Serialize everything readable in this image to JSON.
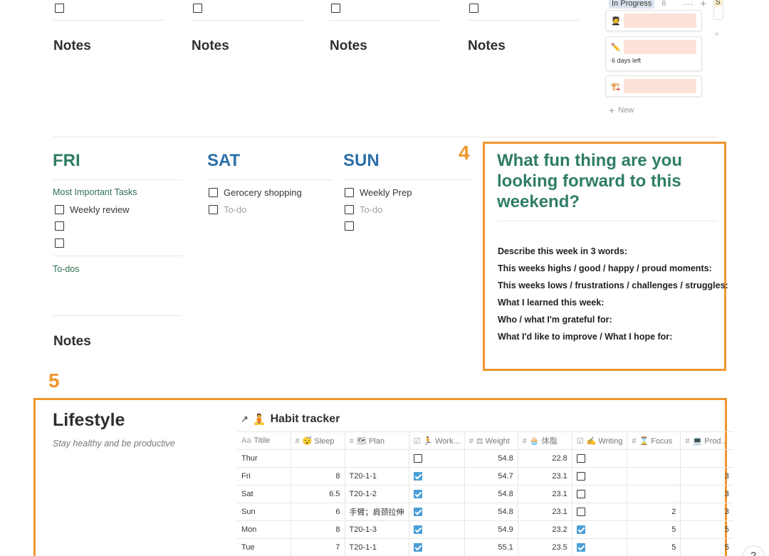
{
  "top_columns": {
    "notes_label": "Notes"
  },
  "kanban": {
    "status": "In Progress",
    "count": "6",
    "more_icon": "ellipsis-icon",
    "add_icon": "plus-icon",
    "cards": [
      {
        "emoji": "🧑‍🎓",
        "sub": ""
      },
      {
        "emoji": "✏️",
        "sub": "6 days left"
      },
      {
        "emoji": "🏗️",
        "sub": ""
      }
    ],
    "new_label": "New"
  },
  "days": {
    "fri": {
      "title": "FRI",
      "important_label": "Most Important Tasks",
      "tasks": [
        "Weekly review",
        "",
        ""
      ],
      "todos_label": "To-dos",
      "notes_label": "Notes"
    },
    "sat": {
      "title": "SAT",
      "tasks": [
        "Gerocery shopping"
      ],
      "placeholder": "To-do"
    },
    "sun": {
      "title": "SUN",
      "tasks": [
        "Weekly Prep"
      ],
      "placeholder": "To-do"
    }
  },
  "callouts": {
    "four": "4",
    "five": "5"
  },
  "weekend": {
    "title": "What fun thing are you looking forward to this weekend?",
    "prompts": [
      "Describe this week in 3 words:",
      "This weeks highs / good / happy / proud moments:",
      "This weeks lows / frustrations / challenges / struggles:",
      "What I learned this week:",
      "Who / what I'm grateful for:",
      "What I'd like to improve / What I hope for:"
    ]
  },
  "lifestyle": {
    "title": "Lifestyle",
    "subtitle": "Stay healthy and be productive",
    "tracker_arrow": "↗",
    "tracker_emoji": "🧘",
    "tracker_title": "Habit tracker",
    "columns": [
      {
        "icon": "Aa",
        "label": "Titile"
      },
      {
        "icon": "#",
        "label": "😴 Sleep"
      },
      {
        "icon": "≡",
        "label": "🗺 Plan"
      },
      {
        "icon": "☑",
        "label": "🏃 Work..."
      },
      {
        "icon": "#",
        "label": "⚖ Weight"
      },
      {
        "icon": "#",
        "label": "🧁 体脂"
      },
      {
        "icon": "☑",
        "label": "✍ Writing"
      },
      {
        "icon": "#",
        "label": "⌛ Focus"
      },
      {
        "icon": "#",
        "label": "💻 Prod..."
      }
    ],
    "rows": [
      {
        "title": "Thur",
        "sleep": "",
        "plan": "",
        "workout": false,
        "weight": "54.8",
        "fat": "22.8",
        "writing": false,
        "focus": "",
        "prod": ""
      },
      {
        "title": "Fri",
        "sleep": "8",
        "plan": "T20-1-1",
        "workout": true,
        "weight": "54.7",
        "fat": "23.1",
        "writing": false,
        "focus": "",
        "prod": "3"
      },
      {
        "title": "Sat",
        "sleep": "6.5",
        "plan": "T20-1-2",
        "workout": true,
        "weight": "54.8",
        "fat": "23.1",
        "writing": false,
        "focus": "",
        "prod": "3"
      },
      {
        "title": "Sun",
        "sleep": "6",
        "plan": "手臂；肩颈拉伸",
        "workout": true,
        "weight": "54.8",
        "fat": "23.1",
        "writing": false,
        "focus": "2",
        "prod": "3"
      },
      {
        "title": "Mon",
        "sleep": "8",
        "plan": "T20-1-3",
        "workout": true,
        "weight": "54.9",
        "fat": "23.2",
        "writing": true,
        "focus": "5",
        "prod": "5"
      },
      {
        "title": "Tue",
        "sleep": "7",
        "plan": "T20-1-1",
        "workout": true,
        "weight": "55.1",
        "fat": "23.5",
        "writing": true,
        "focus": "5",
        "prod": "5"
      }
    ]
  },
  "help_label": "?"
}
